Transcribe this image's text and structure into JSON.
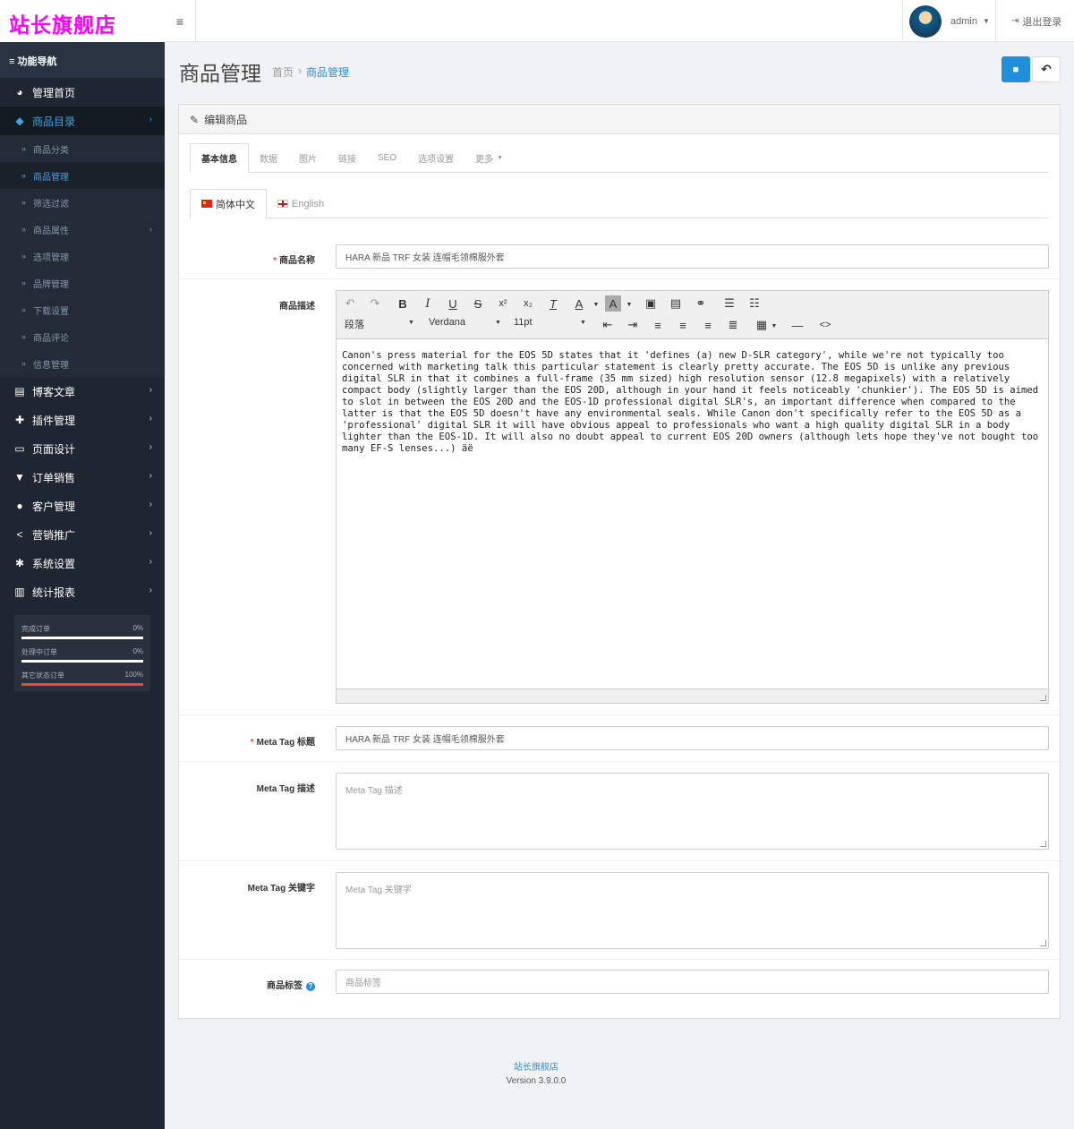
{
  "brand": "站长旗舰店",
  "nav_title": "≡ 功能导航",
  "menu": {
    "dashboard": "管理首页",
    "catalog": "商品目录",
    "blog": "博客文章",
    "plugins": "插件管理",
    "design": "页面设计",
    "orders": "订单销售",
    "customers": "客户管理",
    "marketing": "营销推广",
    "settings": "系统设置",
    "reports": "统计报表"
  },
  "catalog_sub": [
    "商品分类",
    "商品管理",
    "筛选过滤",
    "商品属性",
    "选项管理",
    "品牌管理",
    "下载设置",
    "商品评论",
    "信息管理"
  ],
  "stats": [
    {
      "label": "完成订单",
      "value": "0%",
      "fraction": 0
    },
    {
      "label": "处理中订单",
      "value": "0%",
      "fraction": 0
    },
    {
      "label": "其它状态订单",
      "value": "100%",
      "fraction": 1
    }
  ],
  "topbar": {
    "username": "admin",
    "logout": "退出登录"
  },
  "page": {
    "title": "商品管理",
    "crumb_home": "首页",
    "crumb_sep": "›",
    "crumb_current": "商品管理"
  },
  "panel": {
    "title": "编辑商品"
  },
  "tabs": [
    "基本信息",
    "数据",
    "图片",
    "链接",
    "SEO",
    "选项设置",
    "更多"
  ],
  "lang_tabs": [
    "简体中文",
    "English"
  ],
  "form": {
    "name_label": "商品名称",
    "name_value": "HARA 新品 TRF 女装 连帽毛领棉服外套",
    "desc_label": "商品描述",
    "meta_title_label": "Meta Tag 标题",
    "meta_title_value": "HARA 新品 TRF 女装 连帽毛领棉服外套",
    "meta_desc_label": "Meta Tag 描述",
    "meta_desc_placeholder": "Meta Tag 描述",
    "meta_kw_label": "Meta Tag 关键字",
    "meta_kw_placeholder": "Meta Tag 关键字",
    "tags_label": "商品标签",
    "tags_placeholder": "商品标签"
  },
  "editor": {
    "format": "段落",
    "font": "Verdana",
    "size": "11pt",
    "content": "Canon's press material for the EOS 5D states that it 'defines (a) new D-SLR category', while we're not typically too concerned with marketing talk this particular statement is clearly pretty accurate. The EOS 5D is unlike any previous digital SLR in that it combines a full-frame (35 mm sized) high resolution sensor (12.8 megapixels) with a relatively compact body (slightly larger than the EOS 20D, although in your hand it feels noticeably 'chunkier'). The EOS 5D is aimed to slot in between the EOS 20D and the EOS-1D professional digital SLR's, an important difference when compared to the latter is that the EOS 5D doesn't have any environmental seals. While Canon don't specifically refer to the EOS 5D as a 'professional' digital SLR it will have obvious appeal to professionals who want a high quality digital SLR in a body lighter than the EOS-1D. It will also no doubt appeal to current EOS 20D owners (although lets hope they've not bought too many EF-S lenses...) äë"
  },
  "footer": {
    "brand": "站长旗舰店",
    "version": "Version 3.9.0.0"
  },
  "colors": {
    "accent": "#1e8fd8",
    "sidebar": "#1f2631",
    "brand": "#ff00ff",
    "danger": "#e74c3c"
  }
}
